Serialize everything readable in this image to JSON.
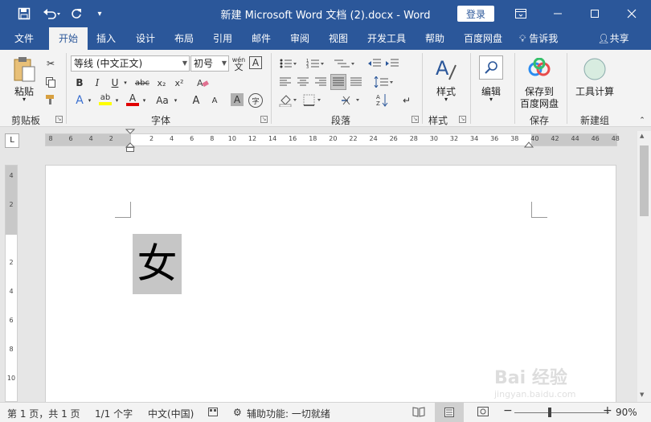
{
  "titlebar": {
    "title": "新建 Microsoft Word 文档 (2).docx  -  Word",
    "login_label": "登录",
    "icons": {
      "save": "save-icon",
      "undo": "undo-icon",
      "redo": "redo-icon",
      "customize": "customize-qat-icon"
    }
  },
  "menu": {
    "items": [
      "文件",
      "开始",
      "插入",
      "设计",
      "布局",
      "引用",
      "邮件",
      "审阅",
      "视图",
      "开发工具",
      "帮助",
      "百度网盘",
      "告诉我",
      "共享"
    ],
    "active": "开始"
  },
  "ribbon": {
    "clipboard": {
      "paste_label": "粘贴",
      "group_label": "剪贴板"
    },
    "font": {
      "font_name": "等线 (中文正文)",
      "font_size": "初号",
      "pinyin_glyph": "wén",
      "group_label": "字体",
      "bold": "B",
      "italic": "I",
      "underline": "U",
      "strike": "abc",
      "subscript": "x₂",
      "superscript": "x²",
      "text_effects": "A",
      "highlight": "ab",
      "font_color": "A",
      "change_case": "Aa",
      "grow": "A",
      "shrink": "A",
      "char_shading": "A",
      "enclose": "字"
    },
    "paragraph": {
      "group_label": "段落"
    },
    "styles": {
      "label": "样式",
      "group_label": "样式"
    },
    "editing": {
      "label": "编辑"
    },
    "save": {
      "label1": "保存到",
      "label2": "百度网盘",
      "group_label": "保存"
    },
    "newgroup": {
      "label": "工具计算",
      "group_label": "新建组"
    }
  },
  "ruler": {
    "h_ticks": [
      "8",
      "6",
      "4",
      "2",
      "",
      "2",
      "4",
      "6",
      "8",
      "10",
      "12",
      "14",
      "16",
      "18",
      "20",
      "22",
      "24",
      "26",
      "28",
      "30",
      "32",
      "34",
      "36",
      "38",
      "40",
      "42",
      "44",
      "46",
      "48"
    ],
    "v_ticks": [
      "4",
      "2",
      "",
      "2",
      "4",
      "6",
      "8",
      "10"
    ],
    "corner_glyph": "L"
  },
  "document": {
    "selected_text": "女"
  },
  "status": {
    "page": "第 1 页，共 1 页",
    "words": "1/1 个字",
    "language": "中文(中国)",
    "accessibility": "辅助功能: 一切就绪",
    "zoom": "90%",
    "zoom_minus": "−",
    "zoom_plus": "+"
  },
  "watermark": {
    "text": "Bai 经验",
    "sub": "jingyan.baidu.com"
  }
}
